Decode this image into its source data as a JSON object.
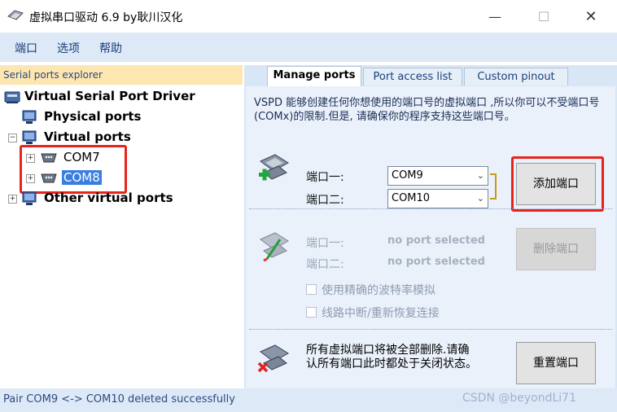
{
  "window": {
    "title": "虚拟串口驱动 6.9 by耿川汉化",
    "min_glyph": "—",
    "max_glyph": "☐",
    "close_glyph": "✕"
  },
  "menu": {
    "items": [
      "端口",
      "选项",
      "帮助"
    ]
  },
  "explorer": {
    "header": "Serial ports explorer",
    "root": "Virtual Serial Port Driver",
    "physical": "Physical ports",
    "virtual": "Virtual ports",
    "com7": "COM7",
    "com8": "COM8",
    "other": "Other virtual ports",
    "expand_glyph": "+",
    "collapse_glyph": "−"
  },
  "tabs": {
    "manage": "Manage ports",
    "access": "Port access list",
    "pinout": "Custom pinout"
  },
  "manage": {
    "description": "VSPD 能够创建任何你想使用的端口号的虚拟端口 ,所以你可以不受端口号(COMx)的限制.但是, 请确保你的程序支持这些端口号。",
    "add": {
      "port1_label": "端口一:",
      "port2_label": "端口二:",
      "port1_value": "COM9",
      "port2_value": "COM10",
      "button": "添加端口",
      "arrow_glyph": "⌄"
    },
    "delete": {
      "port1_label": "端口一:",
      "port2_label": "端口二:",
      "port1_value": "no port selected",
      "port2_value": "no port selected",
      "button": "删除端口",
      "chk_baud": "使用精确的波特率模拟",
      "chk_reconnect": "线路中断/重新恢复连接"
    },
    "reset": {
      "text": "所有虚拟端口将被全部删除.请确认所有端口此时都处于关闭状态。",
      "button": "重置端口"
    }
  },
  "status": {
    "text": "Pair COM9 <-> COM10 deleted successfully"
  },
  "watermark": "CSDN @beyondLi71",
  "colors": {
    "menubar": "#dde9f6",
    "highlight": "#e8231c",
    "selection": "#3a7fe0",
    "pane_header": "#fde6b0"
  }
}
